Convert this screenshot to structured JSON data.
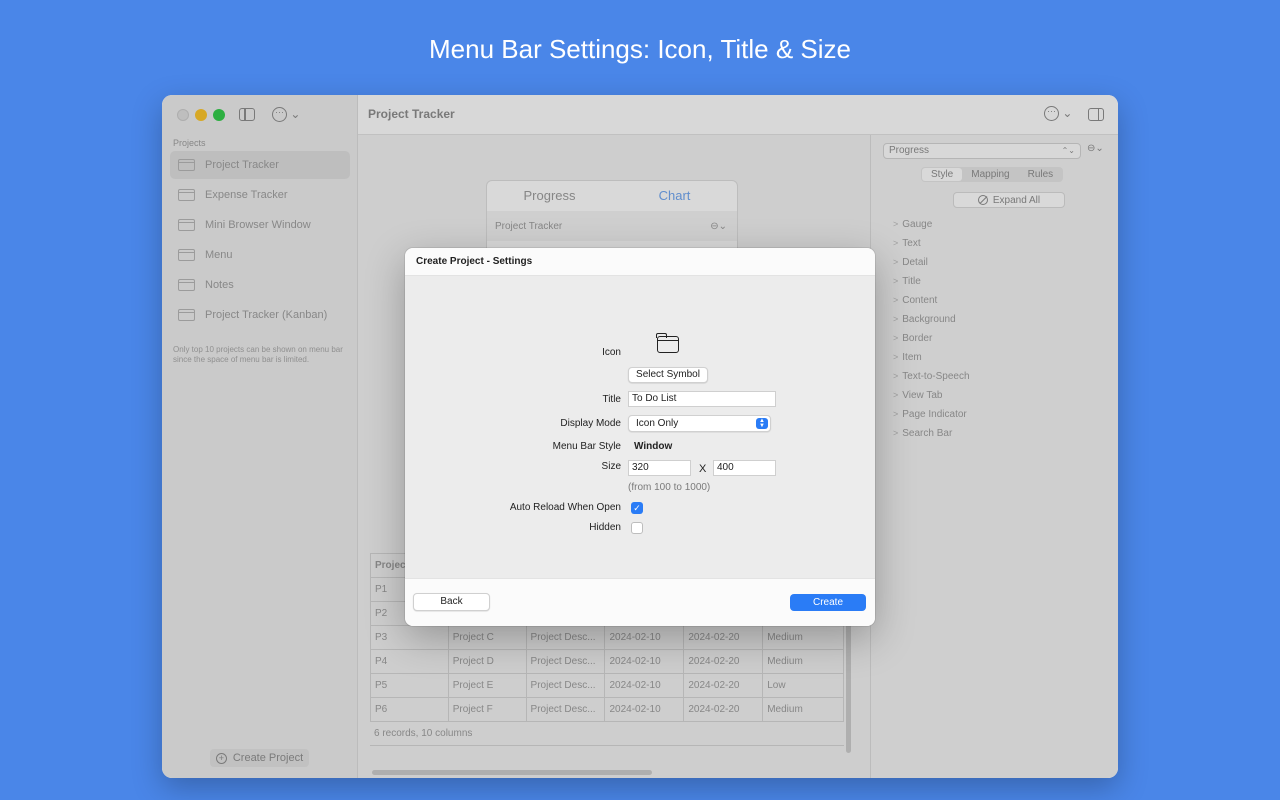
{
  "banner": {
    "title": "Menu Bar Settings: Icon, Title & Size"
  },
  "sidebar": {
    "section_label": "Projects",
    "items": [
      {
        "label": "Project Tracker"
      },
      {
        "label": "Expense Tracker"
      },
      {
        "label": "Mini Browser Window"
      },
      {
        "label": "Menu"
      },
      {
        "label": "Notes"
      },
      {
        "label": "Project Tracker (Kanban)"
      }
    ],
    "note": "Only top 10 projects can be shown on menu bar since the space of menu bar is limited.",
    "create_label": "Create Project"
  },
  "toolbar": {
    "title": "Project Tracker"
  },
  "preview": {
    "tab_progress": "Progress",
    "tab_chart": "Chart",
    "row_label": "Project Tracker"
  },
  "table": {
    "header_first": "Projec",
    "rows": [
      [
        "P1",
        "",
        "",
        "",
        "",
        ""
      ],
      [
        "P2",
        "",
        "",
        "",
        "",
        ""
      ],
      [
        "P3",
        "Project C",
        "Project Desc...",
        "2024-02-10",
        "2024-02-20",
        "Medium"
      ],
      [
        "P4",
        "Project D",
        "Project Desc...",
        "2024-02-10",
        "2024-02-20",
        "Medium"
      ],
      [
        "P5",
        "Project E",
        "Project Desc...",
        "2024-02-10",
        "2024-02-20",
        "Low"
      ],
      [
        "P6",
        "Project F",
        "Project Desc...",
        "2024-02-10",
        "2024-02-20",
        "Medium"
      ]
    ],
    "footer": "6 records, 10 columns"
  },
  "inspector": {
    "selected": "Progress",
    "segments": [
      "Style",
      "Mapping",
      "Rules"
    ],
    "expand_label": "Expand All",
    "properties": [
      "Gauge",
      "Text",
      "Detail",
      "Title",
      "Content",
      "Background",
      "Border",
      "Item",
      "Text-to-Speech",
      "View Tab",
      "Page Indicator",
      "Search Bar"
    ]
  },
  "modal": {
    "title": "Create Project - Settings",
    "icon_label": "Icon",
    "select_symbol_label": "Select Symbol",
    "title_label": "Title",
    "title_value": "To Do List",
    "display_mode_label": "Display Mode",
    "display_mode_value": "Icon Only",
    "menu_bar_style_label": "Menu Bar Style",
    "menu_bar_style_value": "Window",
    "size_label": "Size",
    "width_value": "320",
    "height_value": "400",
    "size_separator": "X",
    "size_hint": "(from 100 to 1000)",
    "auto_reload_label": "Auto Reload When Open",
    "auto_reload_checked": true,
    "hidden_label": "Hidden",
    "hidden_checked": false,
    "back_label": "Back",
    "create_label": "Create"
  },
  "colors": {
    "background": "#4a86e8",
    "accent": "#2a7cf6"
  }
}
